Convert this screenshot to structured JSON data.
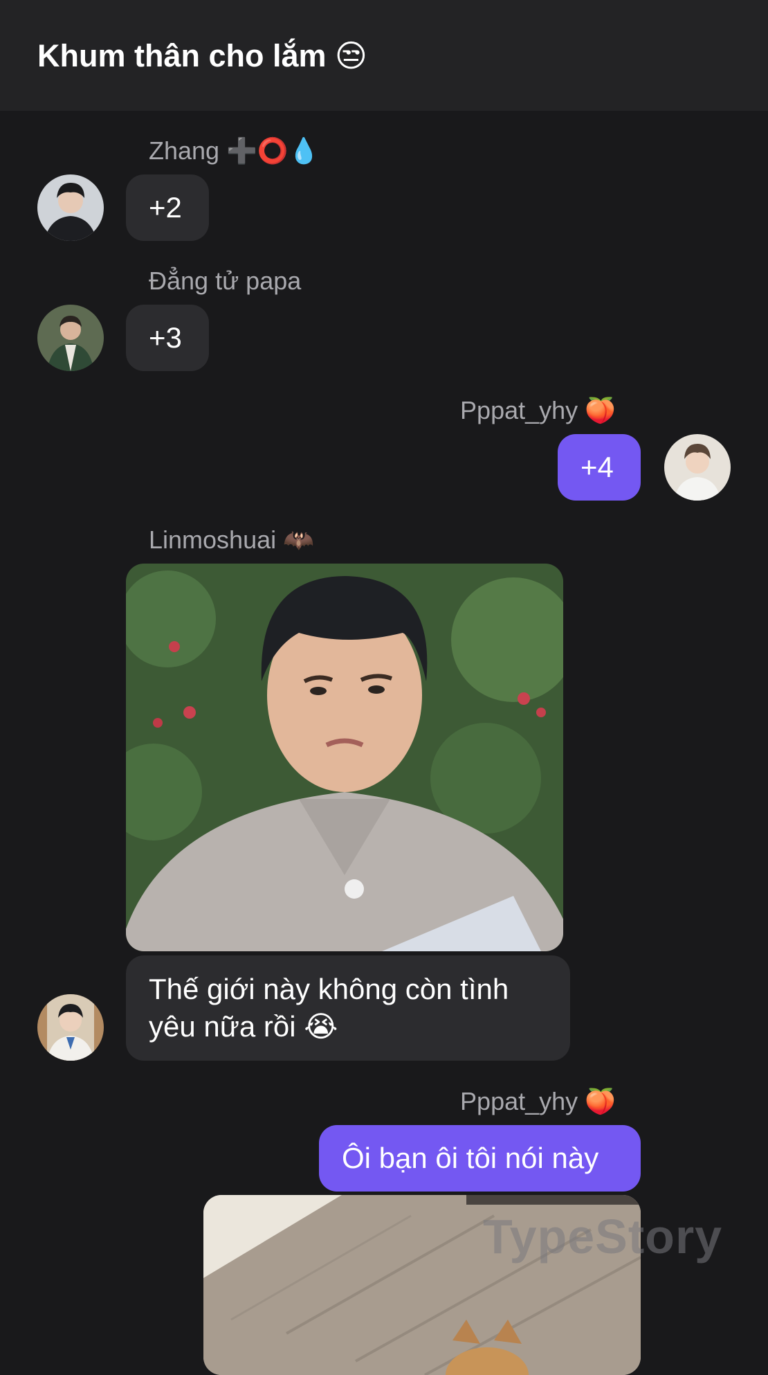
{
  "header": {
    "title": "Khum thân cho lắm 😒"
  },
  "messages": [
    {
      "sender": "Zhang ➕⭕💧",
      "text": "+2"
    },
    {
      "sender": "Đẳng tử papa",
      "text": "+3"
    },
    {
      "sender": "Pppat_yhy 🍑",
      "text": "+4"
    },
    {
      "sender": "Linmoshuai 🦇",
      "text_line1": "Thế giới này không còn tình",
      "text_line2": "yêu nữa rồi 😭"
    },
    {
      "sender": "Pppat_yhy 🍑",
      "text": "Ôi bạn ôi tôi nói này"
    }
  ],
  "watermark": "TypeStory",
  "colors": {
    "background": "#19191b",
    "header": "#232325",
    "bubble_other": "#2c2c2f",
    "bubble_mine": "#7458f2"
  }
}
